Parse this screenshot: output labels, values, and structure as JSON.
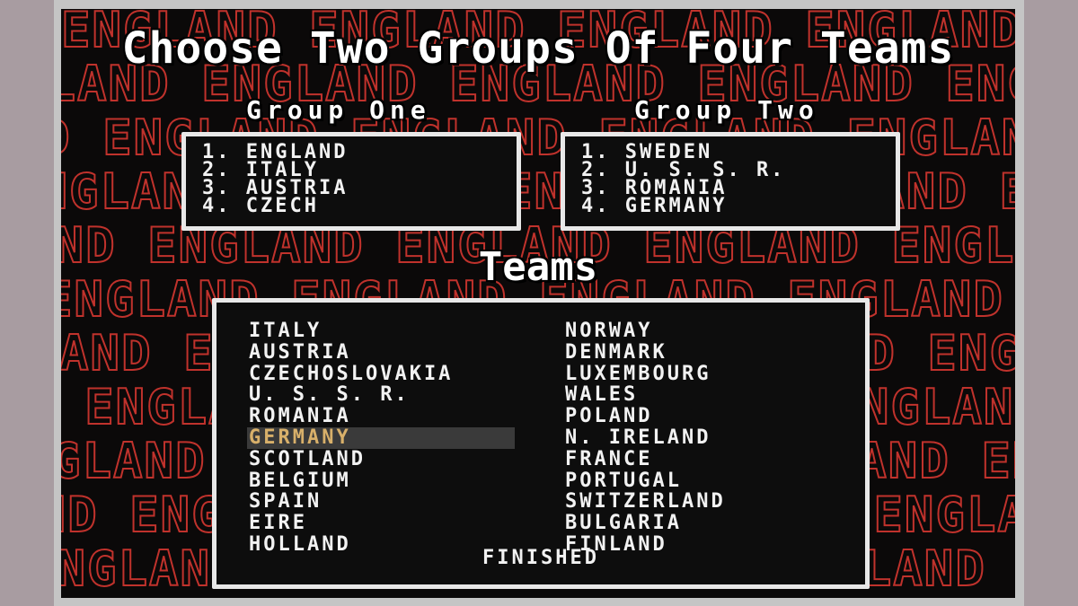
{
  "title": "Choose Two Groups Of Four Teams",
  "background_word": "ENGLAND",
  "group_one": {
    "label": "Group One",
    "teams": [
      "1. ENGLAND",
      "2. ITALY",
      "3. AUSTRIA",
      "4. CZECH"
    ]
  },
  "group_two": {
    "label": "Group Two",
    "teams": [
      "1. SWEDEN",
      "2. U. S. S. R.",
      "3. ROMANIA",
      "4. GERMANY"
    ]
  },
  "teams_title": "Teams",
  "teams_left": [
    "ITALY",
    "AUSTRIA",
    "CZECHOSLOVAKIA",
    "U. S. S. R.",
    "ROMANIA",
    "GERMANY",
    "SCOTLAND",
    "BELGIUM",
    "SPAIN",
    "EIRE",
    "HOLLAND"
  ],
  "teams_right": [
    "NORWAY",
    "DENMARK",
    "LUXEMBOURG",
    "WALES",
    "POLAND",
    "N. IRELAND",
    "FRANCE",
    "PORTUGAL",
    "SWITZERLAND",
    "BULGARIA",
    "FINLAND"
  ],
  "selected_team": "GERMANY",
  "finished_label": "FINISHED",
  "colors": {
    "pattern_red": "#c0322c",
    "highlight_text": "#d8b06a",
    "highlight_bg": "#3a3a3a"
  }
}
